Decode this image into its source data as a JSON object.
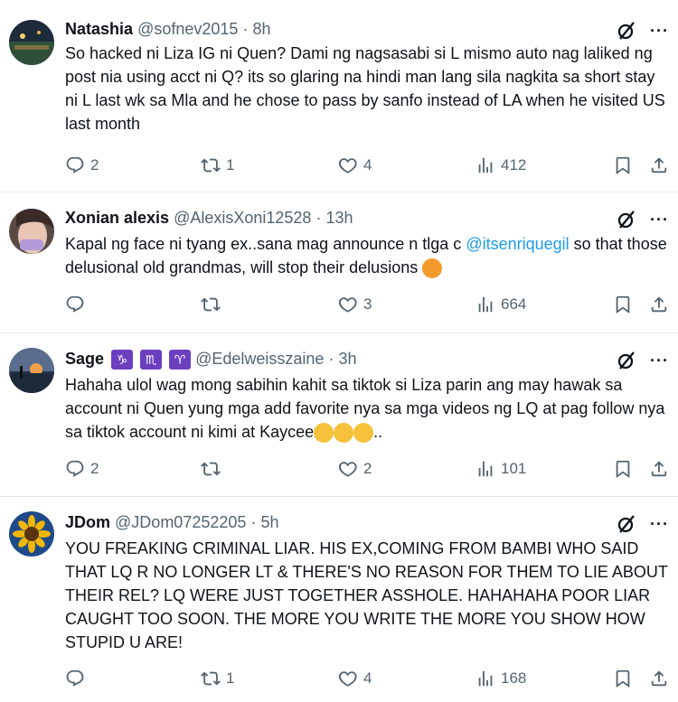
{
  "tweets": [
    {
      "name": "Natashia",
      "handle": "@sofnev2015",
      "time": "8h",
      "text": "So hacked ni Liza IG ni Quen? Dami ng nagsasabi si L mismo auto nag laliked ng post nia using acct ni Q? its so glaring na hindi man lang sila nagkita sa short stay ni L last wk sa Mla and he chose to pass by sanfo instead of LA when he visited US last month",
      "replies": "2",
      "reposts": "1",
      "likes": "4",
      "views": "412"
    },
    {
      "name": "Xonian alexis",
      "handle": "@AlexisXoni12528",
      "time": "13h",
      "text_before": "Kapal ng face ni tyang ex..sana mag announce n tlga c ",
      "mention": "@itsenriquegil",
      "text_after": "  so that those delusional old grandmas, will stop their delusions",
      "replies": "",
      "reposts": "",
      "likes": "3",
      "views": "664"
    },
    {
      "name": "Sage",
      "badges": [
        "♑",
        "♏",
        "♈"
      ],
      "handle": "@Edelweisszaine",
      "time": "3h",
      "text": "Hahaha ulol wag mong sabihin kahit sa tiktok si Liza parin ang may hawak sa account ni Quen yung mga add favorite nya sa mga videos ng LQ at pag follow nya sa tiktok account ni kimi at Kaycee",
      "text_tail": "..",
      "replies": "2",
      "reposts": "",
      "likes": "2",
      "views": "101"
    },
    {
      "name": "JDom",
      "handle": "@JDom07252205",
      "time": "5h",
      "text": "YOU FREAKING CRIMINAL LIAR. HIS EX,COMING FROM BAMBI WHO SAID THAT LQ R NO LONGER LT & THERE'S NO REASON FOR THEM TO LIE ABOUT THEIR REL?  LQ WERE JUST TOGETHER ASSHOLE. HAHAHAHA POOR LIAR CAUGHT TOO SOON. THE MORE YOU WRITE THE MORE YOU SHOW HOW STUPID U ARE!",
      "replies": "",
      "reposts": "1",
      "likes": "4",
      "views": "168"
    }
  ],
  "separator": "·",
  "more_label": "···",
  "colors": {
    "text": "#0f1419",
    "muted": "#536471",
    "link": "#1d9bf0",
    "border": "#e6e9ec"
  }
}
